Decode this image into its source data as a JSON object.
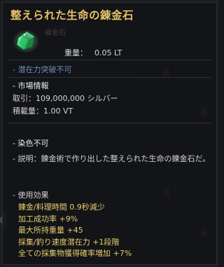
{
  "tooltip": {
    "title": "整えられた生命の錬金石",
    "ghost_text": "錬金石",
    "weight_label": "重量：",
    "weight_value": "0.05 LT",
    "awaken_note": "- 潜在力突破不可",
    "market_header": "- 市場情報",
    "trade_line": "取引：109,000,000 シルバー",
    "capacity_line": "積載量：1.00 VT",
    "dye_note": "- 染色不可",
    "description": "- 説明：錬金術で作り出した整えられた生命の錬金石だ。",
    "effects_header": "- 使用効果",
    "effects": [
      "錬金/料理時間 0.9秒減少",
      "加工成功率 +9%",
      "最大所持重量 +45",
      "採集/釣り速度潜在力 +1段階",
      "全ての採集物獲得確率増加 +7%"
    ],
    "item_icon": "green-gem-icon"
  },
  "colors": {
    "title": "#e7c26a",
    "effect_text": "#e6cd6e",
    "note_blue": "#6f8fb8",
    "body_text": "#d4d4d4"
  }
}
